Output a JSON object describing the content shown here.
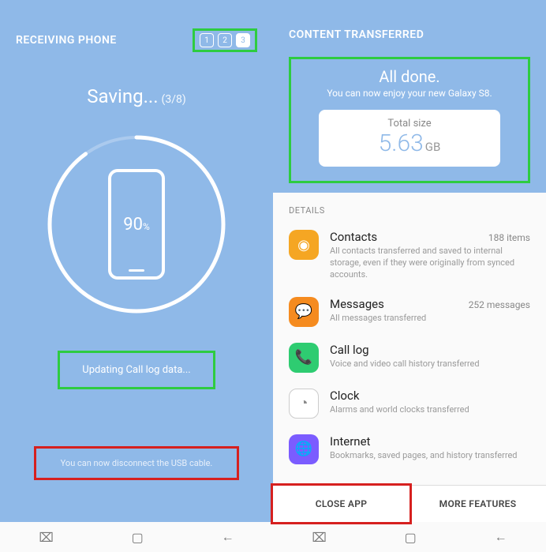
{
  "left": {
    "header_title": "RECEIVING PHONE",
    "steps": [
      "1",
      "2",
      "3"
    ],
    "active_step_index": 2,
    "saving_label": "Saving...",
    "saving_progress": "(3/8)",
    "percent": "90",
    "percent_sign": "%",
    "status": "Updating Call log data...",
    "disconnect_msg": "You can now disconnect the USB cable."
  },
  "right": {
    "header_title": "CONTENT TRANSFERRED",
    "done_title": "All done.",
    "done_sub": "You can now enjoy your new Galaxy S8.",
    "size_label": "Total size",
    "size_value": "5.63",
    "size_unit": "GB",
    "details_label": "DETAILS",
    "items": [
      {
        "icon": "contacts",
        "color": "#f5a623",
        "title": "Contacts",
        "count": "188 items",
        "desc": "All contacts transferred and saved to internal storage, even if they were originally from synced accounts."
      },
      {
        "icon": "messages",
        "color": "#f58b1f",
        "title": "Messages",
        "count": "252 messages",
        "desc": "All messages transferred"
      },
      {
        "icon": "phone",
        "color": "#2ecc71",
        "title": "Call log",
        "count": "",
        "desc": "Voice and video call history transferred"
      },
      {
        "icon": "clock",
        "color": "#ffffff",
        "title": "Clock",
        "count": "",
        "desc": "Alarms and world clocks transferred"
      },
      {
        "icon": "globe",
        "color": "#7b5cff",
        "title": "Internet",
        "count": "",
        "desc": "Bookmarks, saved pages, and history transferred"
      }
    ],
    "close_btn": "CLOSE APP",
    "more_btn": "MORE FEATURES"
  }
}
